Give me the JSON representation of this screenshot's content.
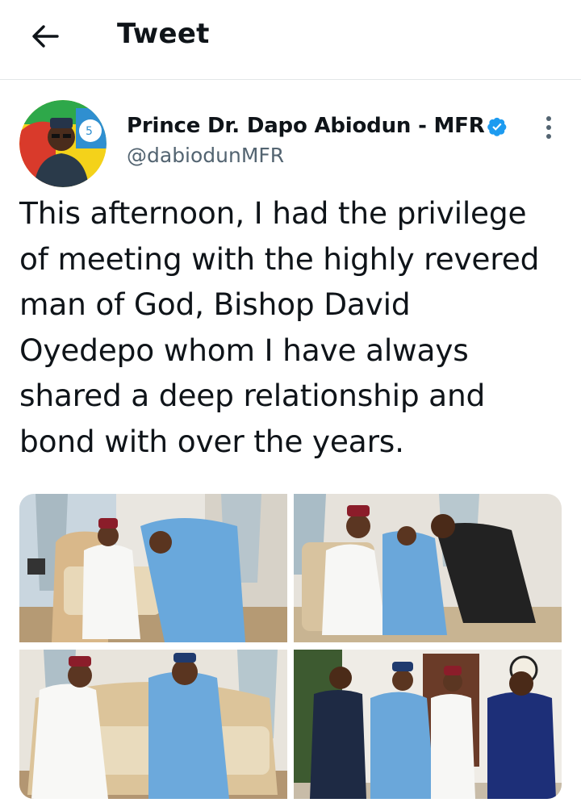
{
  "header": {
    "title": "Tweet",
    "back_icon": "arrow-left-icon"
  },
  "author": {
    "name": "Prince Dr. Dapo Abiodun - MFR",
    "handle": "@dabiodunMFR",
    "verified_icon": "verified-badge-icon",
    "verified_color": "#1d9bf0"
  },
  "tweet": {
    "text": "This afternoon, I had the privilege\nof meeting with the highly revered\nman of God, Bishop David\nOyedepo whom I have always\nshared a deep relationship and\nbond with over the years."
  },
  "media": {
    "photo_count": 4
  },
  "colors": {
    "text": "#0f1419",
    "secondary": "#536471",
    "divider": "#e3e6e8"
  }
}
